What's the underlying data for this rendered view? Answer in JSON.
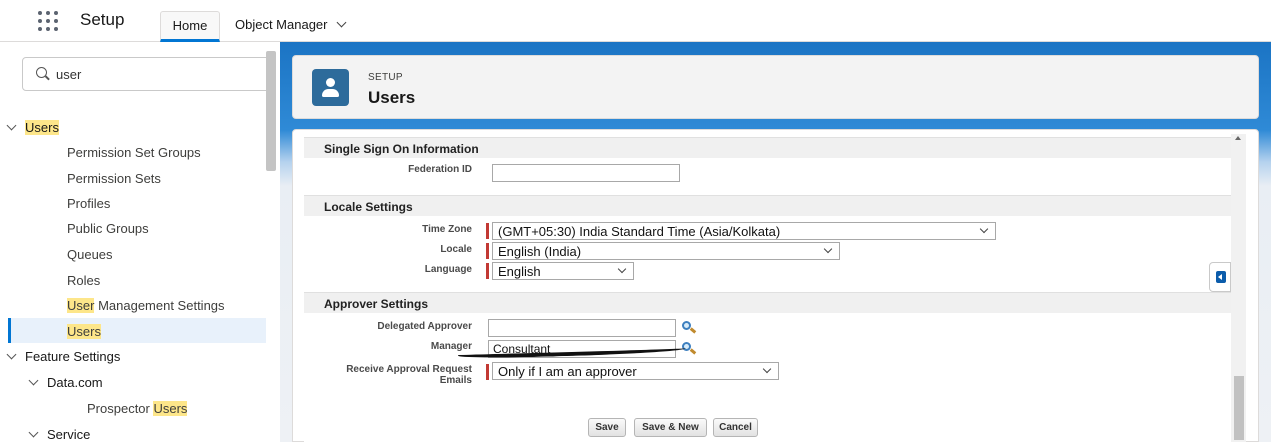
{
  "topbar": {
    "app_name": "Setup",
    "tabs": [
      {
        "label": "Home",
        "active": true
      },
      {
        "label": "Object Manager",
        "has_dropdown": true
      }
    ]
  },
  "sidebar": {
    "search": {
      "value": "user",
      "highlight_term": "User"
    },
    "items": [
      {
        "label": "Users",
        "type": "group",
        "expanded": true
      },
      {
        "label": "Permission Set Groups"
      },
      {
        "label": "Permission Sets"
      },
      {
        "label": "Profiles"
      },
      {
        "label": "Public Groups"
      },
      {
        "label": "Queues"
      },
      {
        "label": "Roles"
      },
      {
        "label_highlight": "User",
        "label_rest": " Management Settings"
      },
      {
        "label": "Users",
        "selected": true
      },
      {
        "label": "Feature Settings",
        "type": "group",
        "expanded": true
      },
      {
        "label": "Data.com",
        "type": "subgroup",
        "expanded": true
      },
      {
        "label_prefix": "Prospector ",
        "label_highlight": "Users"
      },
      {
        "label": "Service",
        "type": "subgroup",
        "expanded": true
      }
    ]
  },
  "header": {
    "eyebrow": "SETUP",
    "title": "Users"
  },
  "form": {
    "sections": {
      "sso": {
        "title": "Single Sign On Information",
        "federation_id": {
          "label": "Federation ID",
          "value": ""
        }
      },
      "locale": {
        "title": "Locale Settings",
        "time_zone": {
          "label": "Time Zone",
          "value": "(GMT+05:30) India Standard Time (Asia/Kolkata)",
          "required": true
        },
        "locale": {
          "label": "Locale",
          "value": "English (India)",
          "required": true
        },
        "language": {
          "label": "Language",
          "value": "English",
          "required": true
        }
      },
      "approver": {
        "title": "Approver Settings",
        "delegated_approver": {
          "label": "Delegated Approver",
          "value": ""
        },
        "manager": {
          "label": "Manager",
          "value": "Consultant"
        },
        "receive_emails": {
          "label_line1": "Receive Approval Request",
          "label_line2": "Emails",
          "value": "Only if I am an approver",
          "required": true
        }
      }
    },
    "buttons": {
      "save": "Save",
      "save_new": "Save & New",
      "cancel": "Cancel"
    }
  },
  "colors": {
    "brand_blue": "#0176d3",
    "required_red": "#c23934",
    "highlight": "#fde68a"
  }
}
